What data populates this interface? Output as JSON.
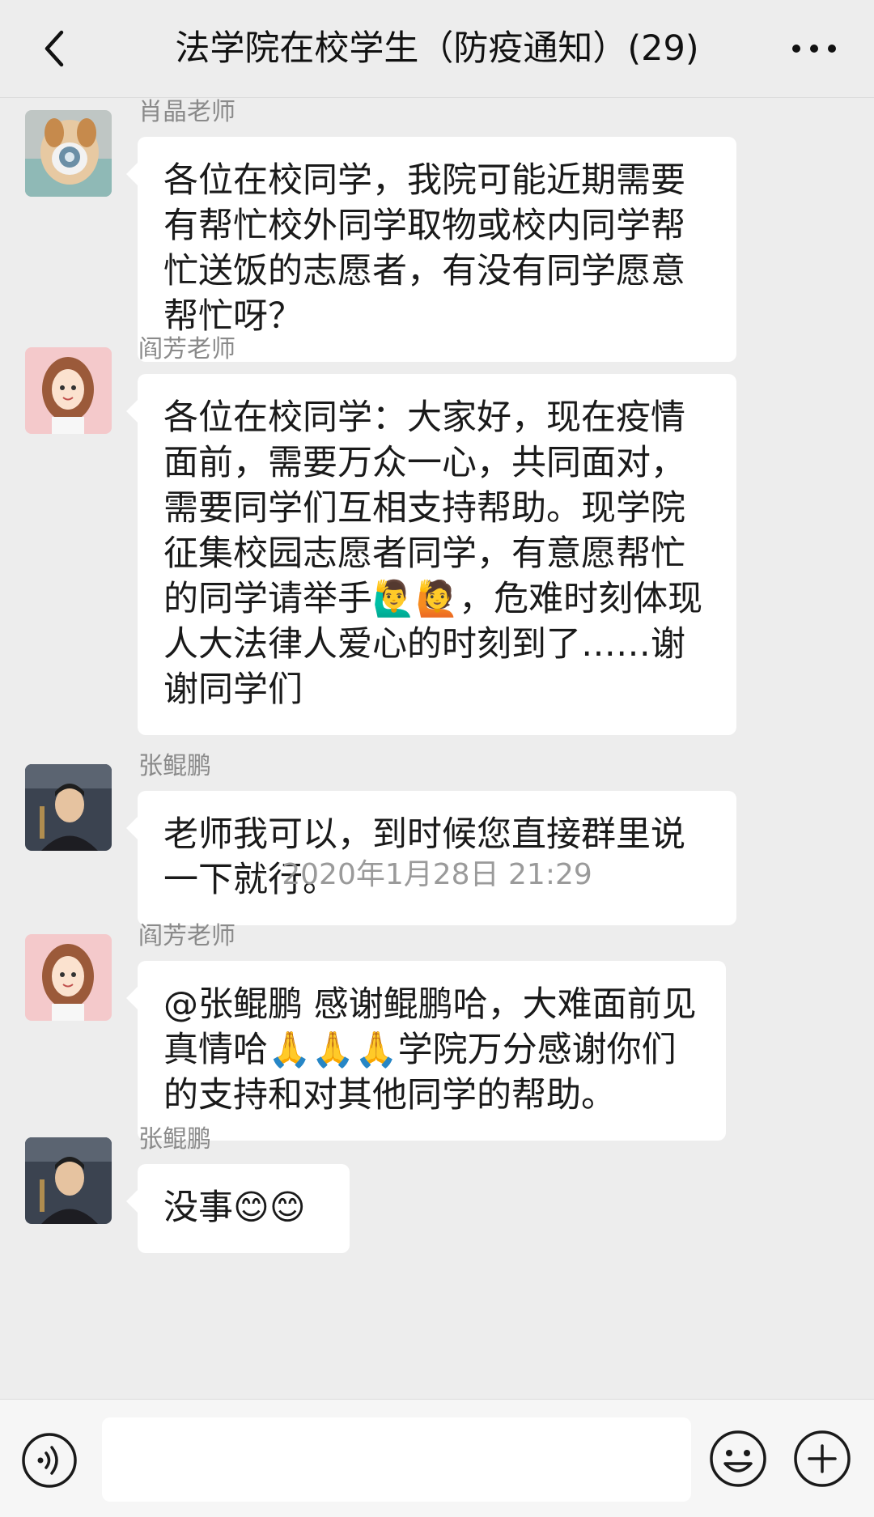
{
  "header": {
    "title": "法学院在校学生（防疫通知）(29)"
  },
  "messages": [
    {
      "sender": "肖晶老师",
      "text": "各位在校同学，我院可能近期需要有帮忙校外同学取物或校内同学帮忙送饭的志愿者，有没有同学愿意帮忙呀？"
    },
    {
      "sender": "阎芳老师",
      "text": "各位在校同学：大家好，现在疫情面前，需要万众一心，共同面对，需要同学们互相支持帮助。现学院征集校园志愿者同学，有意愿帮忙的同学请举手🙋‍♂️🙋，危难时刻体现人大法律人爱心的时刻到了……谢谢同学们"
    },
    {
      "sender": "张鲲鹏",
      "text": "老师我可以，到时候您直接群里说一下就行。"
    },
    {
      "sender": "阎芳老师",
      "text": "@张鲲鹏 感谢鲲鹏哈，大难面前见真情哈🙏🙏🙏学院万分感谢你们的支持和对其他同学的帮助。"
    },
    {
      "sender": "张鲲鹏",
      "text": "没事😊😊"
    }
  ],
  "timestamp": "2020年1月28日 21:29",
  "input": {
    "placeholder": ""
  },
  "icons": {
    "back": "back-chevron-icon",
    "more": "more-dots-icon",
    "voice": "voice-icon",
    "emoji": "emoji-smiley-icon",
    "plus": "plus-icon"
  }
}
